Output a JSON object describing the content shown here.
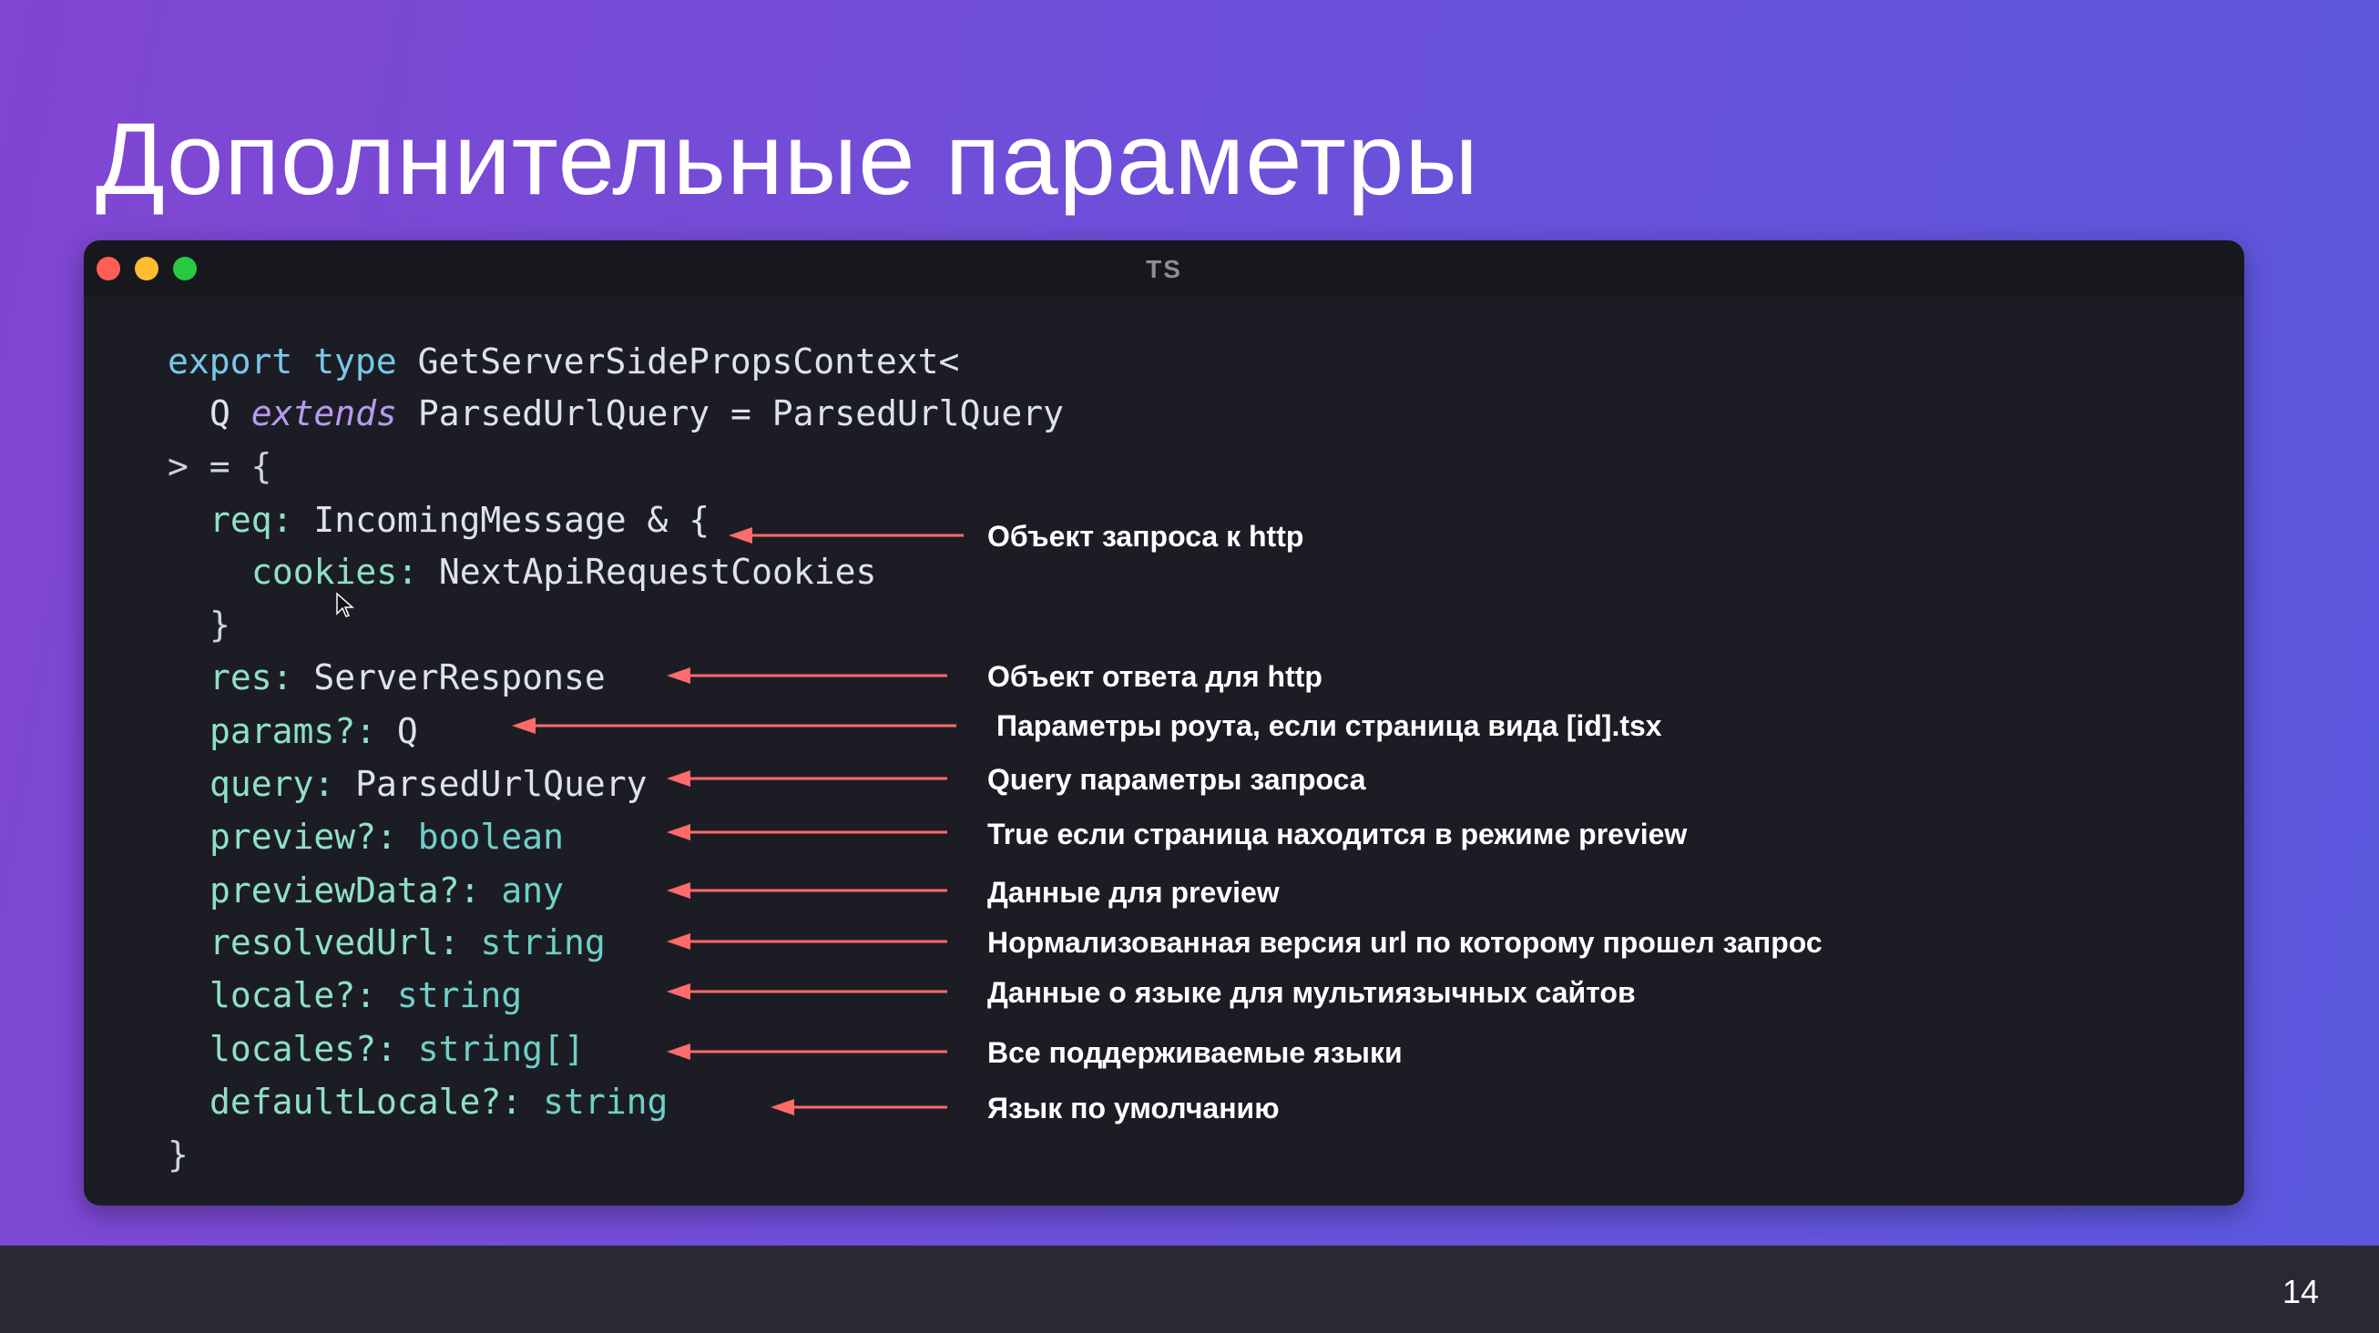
{
  "slide": {
    "title": "Дополнительные параметры",
    "page_number": "14",
    "colors": {
      "background_start": "#8146d2",
      "background_end": "#5b58de",
      "arrow": "#ff6a6a",
      "window_bg": "#1c1d24"
    }
  },
  "window": {
    "language_label": "TS",
    "buttons": [
      "close-icon",
      "minimize-icon",
      "maximize-icon"
    ]
  },
  "code": {
    "l1": {
      "export": "export",
      "type": "type",
      "name": "GetServerSidePropsContext<"
    },
    "l2": {
      "q": "Q",
      "extends": "extends",
      "rest": "ParsedUrlQuery = ParsedUrlQuery"
    },
    "l3": {
      "text": "> = {"
    },
    "l4": {
      "prop": "req:",
      "type": "IncomingMessage & {"
    },
    "l5": {
      "prop": "cookies:",
      "type": "NextApiRequestCookies"
    },
    "l6": {
      "text": "}"
    },
    "l7": {
      "prop": "res:",
      "type": "ServerResponse"
    },
    "l8": {
      "prop": "params?:",
      "type": "Q"
    },
    "l9": {
      "prop": "query:",
      "type": "ParsedUrlQuery"
    },
    "l10": {
      "prop": "preview?:",
      "type": "boolean"
    },
    "l11": {
      "prop": "previewData?:",
      "type": "any"
    },
    "l12": {
      "prop": "resolvedUrl:",
      "type": "string"
    },
    "l13": {
      "prop": "locale?:",
      "type": "string"
    },
    "l14": {
      "prop": "locales?:",
      "type": "string[]"
    },
    "l15": {
      "prop": "defaultLocale?:",
      "type": "string"
    },
    "l16": {
      "text": "}"
    }
  },
  "annotations": {
    "req": "Объект запроса к http",
    "res": "Объект ответа для http",
    "params": "Параметры роута, если страница вида [id].tsx",
    "query": "Query параметры запроса",
    "preview": "True если страница находится в режиме preview",
    "previewData": "Данные для preview",
    "resolvedUrl": "Нормализованная версия url по которому прошел запрос",
    "locale": "Данные о языке для мультиязычных сайтов",
    "locales": "Все поддерживаемые языки",
    "defaultLocale": "Язык по умолчанию"
  }
}
